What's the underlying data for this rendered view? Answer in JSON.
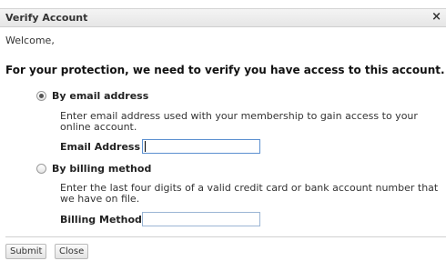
{
  "dialog": {
    "title": "Verify Account",
    "close_glyph": "×",
    "welcome": "Welcome,",
    "heading": "For your protection, we need to verify you have access to this account."
  },
  "options": [
    {
      "label": "By email address",
      "selected": true,
      "description": "Enter email address used with your membership to gain access to your online account.",
      "field_label": "Email Address",
      "field_value": ""
    },
    {
      "label": "By billing method",
      "selected": false,
      "description": "Enter the last four digits of a valid credit card or bank account number that we have on file.",
      "field_label": "Billing Method",
      "field_value": ""
    }
  ],
  "buttons": {
    "submit": "Submit",
    "close": "Close"
  }
}
